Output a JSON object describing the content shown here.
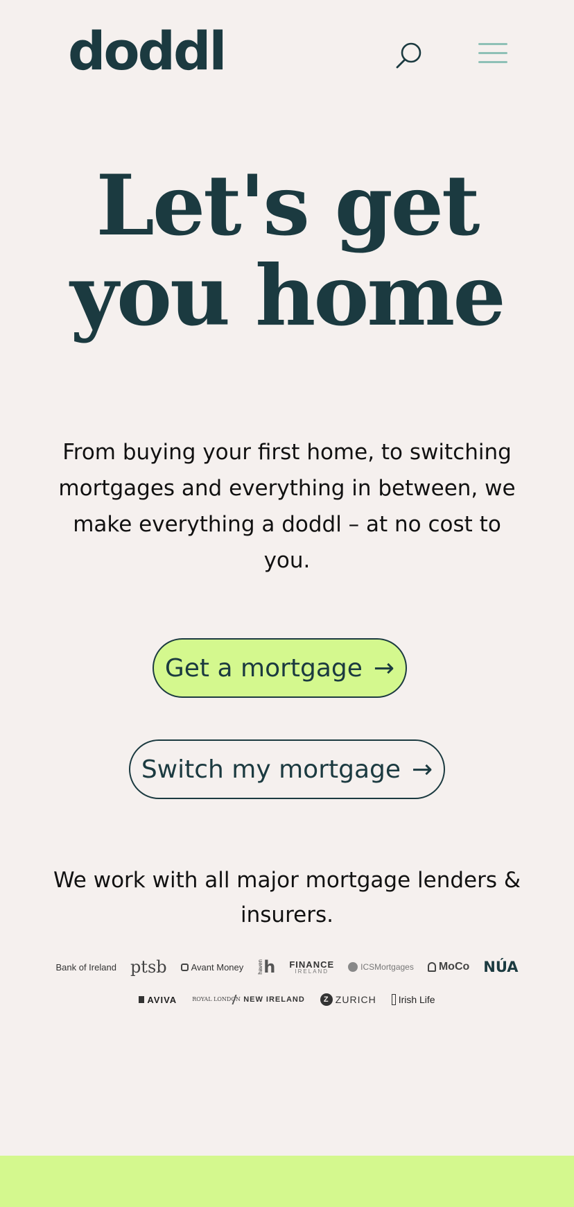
{
  "header": {
    "logo": "doddl",
    "search_icon": "search-icon",
    "menu_icon": "hamburger-menu-icon",
    "menu_color": "#8ec0b6"
  },
  "hero": {
    "title_line1": "Let's get",
    "title_line2": "you home",
    "subtitle": "From buying your first home, to switching mortgages and everything in between, we make everything a doddl – at no cost to you."
  },
  "buttons": {
    "primary_label": "Get a mortgage",
    "secondary_label": "Switch my mortgage",
    "arrow": "→",
    "primary_color": "#d4f88e"
  },
  "lenders": {
    "text": "We work with all major mortgage lenders & insurers.",
    "row1": [
      "Bank of Ireland",
      "ptsb",
      "Avant Money",
      "haven",
      "FINANCE",
      "ICSMortgages",
      "MoCo",
      "NÚA"
    ],
    "row1_finance_sub": "IRELAND",
    "row2": [
      "AVIVA",
      "ROYAL LONDON",
      "NEW IRELAND",
      "ZURICH",
      "Irish Life"
    ]
  },
  "colors": {
    "background": "#f5f0ee",
    "brand_dark": "#1b3a40",
    "accent_lime": "#d4f88e"
  }
}
